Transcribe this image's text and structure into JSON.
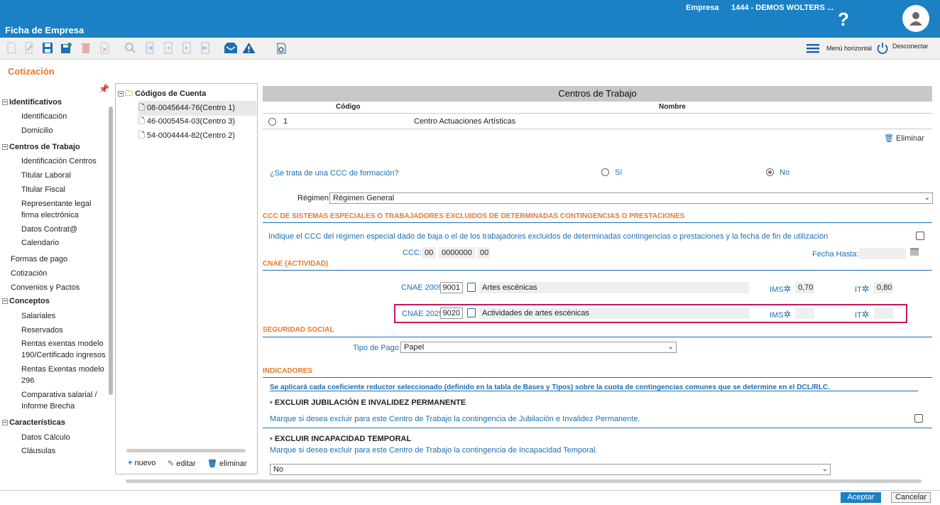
{
  "header": {
    "app_title": "Ficha de Empresa",
    "company_label": "Empresa",
    "company_value": "1444 - DEMOS WOLTERS ...",
    "help": "?"
  },
  "toolbar": {
    "menu_horizontal": "Menú horizontal",
    "disconnect": "Desconectar"
  },
  "section_title": "Cotización",
  "nav": {
    "identificativos": "Identificativos",
    "identificacion": "Identificación",
    "domicilio": "Domicilio",
    "centros_trabajo": "Centros de Trabajo",
    "identificacion_centros": "Identificación Centros",
    "titular_laboral": "Titular Laboral",
    "titular_fiscal": "Titular Fiscal",
    "representante_1": "Representante legal",
    "representante_2": "firma electrónica",
    "datos_contrat": "Datos Contrat@",
    "calendario": "Calendario",
    "formas_pago": "Formas de pago",
    "cotizacion": "Cotización",
    "convenios": "Convenios y Pactos",
    "conceptos": "Conceptos",
    "salariales": "Salariales",
    "reservados": "Reservados",
    "rentas190_1": "Rentas exentas modelo",
    "rentas190_2": "190/Certificado ingresos",
    "rentas296_1": "Rentas Exentas modelo",
    "rentas296_2": "296",
    "comparativa_1": "Comparativa salarial /",
    "comparativa_2": "Informe Brecha",
    "caracteristicas": "Características",
    "datos_calculo": "Datos Cálculo",
    "clausulas": "Cláusulas"
  },
  "codes": {
    "root": "Códigos de Cuenta",
    "items": [
      "08-0045644-76(Centro 1)",
      "46-0005454-03(Centro 3)",
      "54-0004444-82(Centro 2)"
    ],
    "new": "nuevo",
    "edit": "editar",
    "delete": "eliminar"
  },
  "centros": {
    "title": "Centros de Trabajo",
    "col_codigo": "Código",
    "col_nombre": "Nombre",
    "row_codigo": "1",
    "row_nombre": "Centro Actuaciones Artísticas",
    "delete": "Eliminar"
  },
  "form": {
    "ccc_formacion_q": "¿Se trata de una CCC de formación?",
    "si": "Sí",
    "no": "No",
    "ccc_formacion_value": "No",
    "regimen_label": "Régimen",
    "regimen_value": "Régimen General",
    "sect_especiales": "CCC DE SISTEMAS ESPECIALES O TRABAJADORES EXCLUIDOS DE DETERMINADAS CONTINGENCIAS O PRESTACIONES",
    "especiales_text": "Indique el CCC del régimen especial dado de baja o el de los trabajadores excluidos de determinadas contingencias o prestaciones y la fecha de fin de utilización",
    "ccc_label": "CCC:",
    "ccc_1": "00",
    "ccc_2": "0000000",
    "ccc_3": "00",
    "fecha_hasta": "Fecha Hasta:",
    "sect_cnae": "CNAE (ACTIVIDAD)",
    "cnae2009_label": "CNAE 2009",
    "cnae2009_code": "9001",
    "cnae2009_desc": "Artes escénicas",
    "cnae2009_ims_label": "IMS",
    "cnae2009_ims": "0,70",
    "cnae2009_it_label": "IT",
    "cnae2009_it": "0,80",
    "cnae2025_label": "CNAE 2025",
    "cnae2025_code": "9020",
    "cnae2025_desc": "Actividades de artes escénicas",
    "cnae2025_ims_label": "IMS",
    "cnae2025_it_label": "IT",
    "sect_seguridad": "SEGURIDAD SOCIAL",
    "tipo_pago_label": "Tipo de Pago",
    "tipo_pago_value": "Papel",
    "sect_indicadores": "INDICADORES",
    "indicadores_note": "Se aplicará cada coeficiente reductor seleccionado (definido en la tabla de Bases y Tipos) sobre la cuota de contingencias comunes que se determine en el DCL/RLC.",
    "excluir_jub_title": "EXCLUIR JUBILACIÓN E INVALIDEZ PERMANENTE",
    "excluir_jub_text": "Marque si desea excluir para este Centro de Trabajo la contingencia de Jubilación e Invalidez Permanente.",
    "excluir_it_title": "EXCLUIR INCAPACIDAD TEMPORAL",
    "excluir_it_text": "Marque si desea excluir para este Centro de Trabajo la contingencia de Incapacidad Temporal.",
    "excluir_it_value": "No"
  },
  "footer": {
    "accept": "Aceptar",
    "cancel": "Cancelar"
  },
  "colors": {
    "brand": "#1b80c4",
    "accent": "#e8792b",
    "highlight": "#c2185b"
  }
}
